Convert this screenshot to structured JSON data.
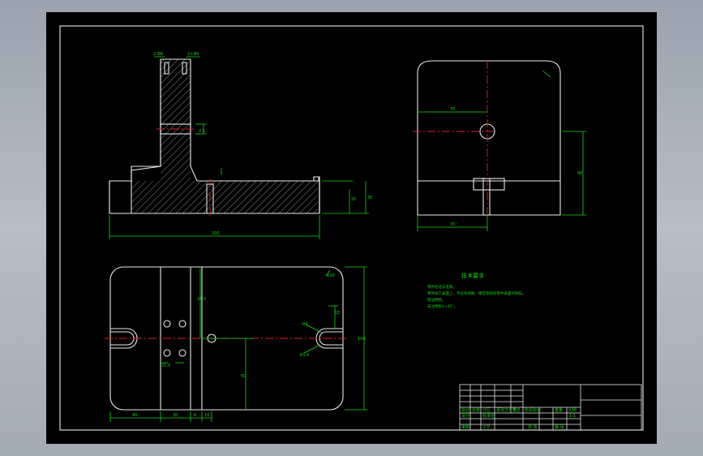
{
  "drawing": {
    "top_view_dims": {
      "top_left": "2-Φ6",
      "top_right": "2×Φ6",
      "slot": "2.5",
      "width": "200",
      "h1": "20",
      "h2": "30"
    },
    "side_view_dims": {
      "top": "70",
      "bottom": "70",
      "height": "80"
    },
    "plan_view_dims": {
      "r_top": "R10",
      "h_left": "24.5",
      "r_slot": "R6",
      "r_slot2": "R5.5",
      "w_right": "15",
      "height": "100",
      "mid": "50",
      "h2": "21.5",
      "b1": "40",
      "b2": "20",
      "b3": "6",
      "b4": "10"
    },
    "tech_notes": {
      "title": "技术要求",
      "lines": [
        "零件毛坯去毛刺。",
        "零件加工表面上，不应有划痕、擦伤等损伤零件表面的缺陷。",
        "锐边倒钝。",
        "未注倒角1×45°。"
      ]
    },
    "title_block": {
      "labels": [
        "标记",
        "处数",
        "分区",
        "更改文件号",
        "签名",
        "年、月、日",
        "设计",
        "标准化",
        "阶段标记",
        "重量",
        "比例",
        "审核",
        "工艺",
        "批准",
        "共 张",
        "第 张"
      ],
      "scale": "1:1"
    }
  }
}
